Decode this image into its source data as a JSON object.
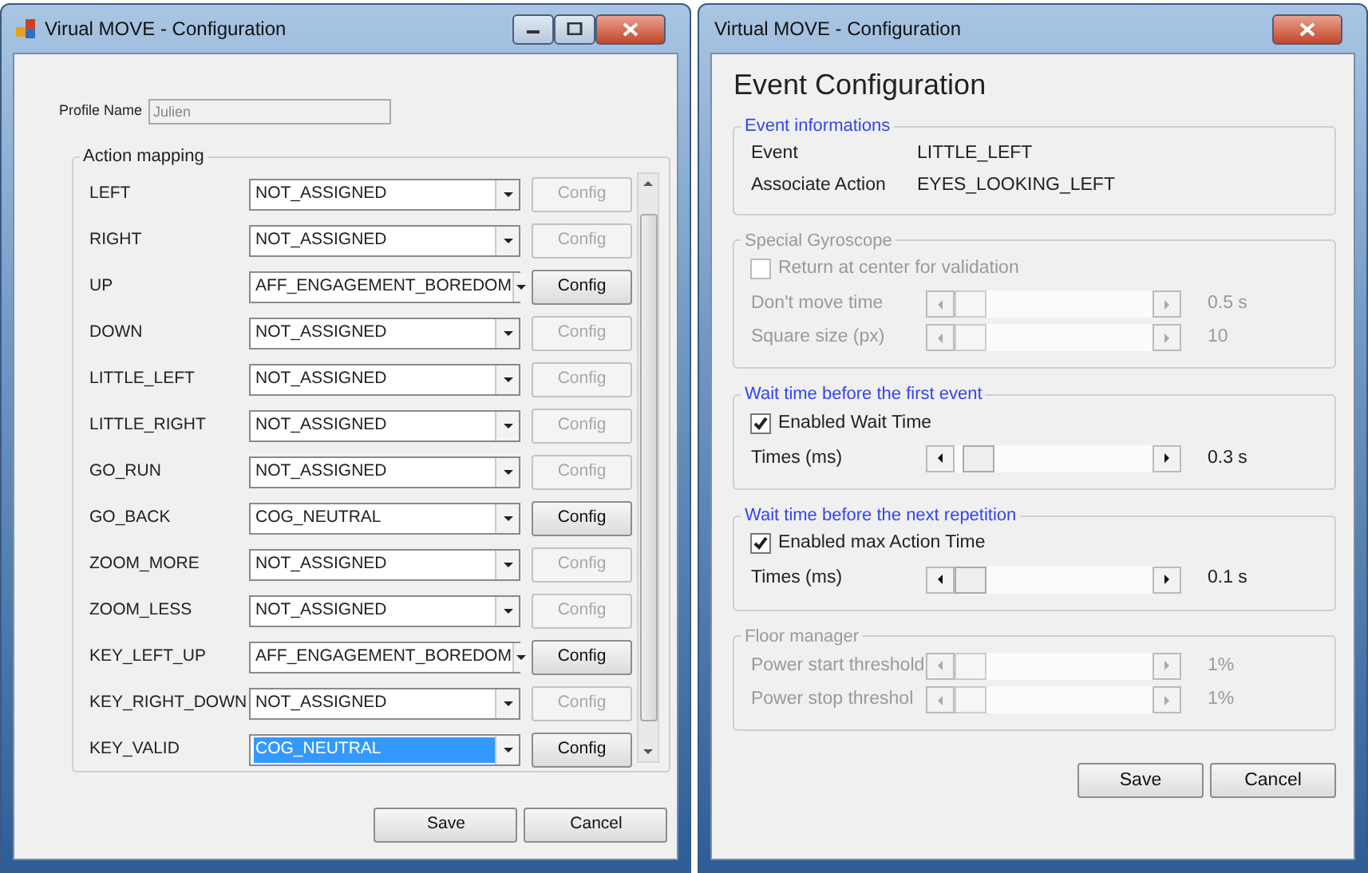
{
  "left_window": {
    "title": "Virual MOVE - Configuration",
    "profile": {
      "label": "Profile Name",
      "value": "Julien",
      "disabled": true
    },
    "mapping": {
      "title": "Action mapping",
      "rows": [
        {
          "event": "LEFT",
          "action": "NOT_ASSIGNED",
          "selected": false,
          "config": "Config",
          "config_enabled": false
        },
        {
          "event": "RIGHT",
          "action": "NOT_ASSIGNED",
          "selected": false,
          "config": "Config",
          "config_enabled": false
        },
        {
          "event": "UP",
          "action": "AFF_ENGAGEMENT_BOREDOM",
          "selected": false,
          "config": "Config",
          "config_enabled": true
        },
        {
          "event": "DOWN",
          "action": "NOT_ASSIGNED",
          "selected": false,
          "config": "Config",
          "config_enabled": false
        },
        {
          "event": "LITTLE_LEFT",
          "action": "NOT_ASSIGNED",
          "selected": false,
          "config": "Config",
          "config_enabled": false
        },
        {
          "event": "LITTLE_RIGHT",
          "action": "NOT_ASSIGNED",
          "selected": false,
          "config": "Config",
          "config_enabled": false
        },
        {
          "event": "GO_RUN",
          "action": "NOT_ASSIGNED",
          "selected": false,
          "config": "Config",
          "config_enabled": false
        },
        {
          "event": "GO_BACK",
          "action": "COG_NEUTRAL",
          "selected": false,
          "config": "Config",
          "config_enabled": true
        },
        {
          "event": "ZOOM_MORE",
          "action": "NOT_ASSIGNED",
          "selected": false,
          "config": "Config",
          "config_enabled": false
        },
        {
          "event": "ZOOM_LESS",
          "action": "NOT_ASSIGNED",
          "selected": false,
          "config": "Config",
          "config_enabled": false
        },
        {
          "event": "KEY_LEFT_UP",
          "action": "AFF_ENGAGEMENT_BOREDOM",
          "selected": false,
          "config": "Config",
          "config_enabled": true
        },
        {
          "event": "KEY_RIGHT_DOWN",
          "action": "NOT_ASSIGNED",
          "selected": false,
          "config": "Config",
          "config_enabled": false
        },
        {
          "event": "KEY_VALID",
          "action": "COG_NEUTRAL",
          "selected": true,
          "config": "Config",
          "config_enabled": true
        }
      ]
    },
    "buttons": [
      "Save",
      "Cancel"
    ]
  },
  "right_window": {
    "title": "Virtual MOVE - Configuration",
    "heading": "Event Configuration",
    "info": {
      "title": "Event informations",
      "rows": [
        {
          "label": "Event",
          "value": "LITTLE_LEFT"
        },
        {
          "label": "Associate Action",
          "value": "EYES_LOOKING_LEFT"
        }
      ]
    },
    "groups": [
      {
        "title": "Special Gyroscope",
        "disabled": true,
        "checkbox": {
          "label": "Return at center for validation",
          "checked": false
        },
        "sliders": [
          {
            "label": "Don't move time",
            "level": 0,
            "reading": "0.5 s"
          },
          {
            "label": "Square size (px)",
            "level": 0,
            "reading": "10"
          }
        ]
      },
      {
        "title": "Wait time before the first event",
        "disabled": false,
        "checkbox": {
          "label": "Enabled Wait Time",
          "checked": true
        },
        "sliders": [
          {
            "label": "Times (ms)",
            "level": 0.04,
            "reading": "0.3 s"
          }
        ]
      },
      {
        "title": "Wait time before the next repetition",
        "disabled": false,
        "checkbox": {
          "label": "Enabled max Action Time",
          "checked": true
        },
        "sliders": [
          {
            "label": "Times (ms)",
            "level": 0,
            "reading": "0.1 s"
          }
        ]
      },
      {
        "title": "Floor manager",
        "disabled": true,
        "sliders": [
          {
            "label": "Power start threshold",
            "level": 0,
            "reading": "1%"
          },
          {
            "label": "Power stop threshol",
            "level": 0,
            "reading": "1%"
          }
        ]
      }
    ],
    "buttons": [
      "Save",
      "Cancel"
    ]
  }
}
